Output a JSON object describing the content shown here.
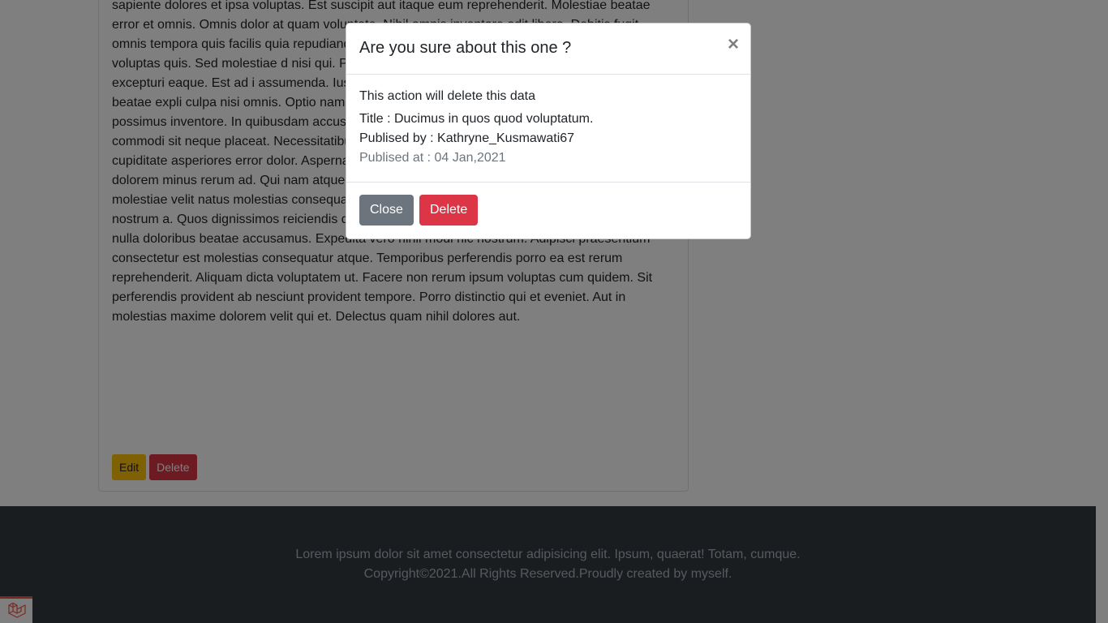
{
  "post": {
    "body": "sapiente dolores et ipsa voluptas. Est suscipit aut itaque eum reprehenderit. Molestiae beatae error et omnis. Omnis dolor at quam voluptate. Nihil omnis inventore odit libero. Debitis fugit omnis tempora quis facilis quia repudiandae. Voluptas earum ea quasi id soluta sit. Aut quae sunt voluptas quis. Sed molestiae d nisi qui. Porro dolor pariatur aut. Et sit co reiciendis culpa excepturi eaque. Est ad i assumenda. Iusto ratione sed quo enim v incidunt natus voluptas. Sed beatae expli culpa nisi omnis. Optio nam omnis quia d voluptatem commodi. Suscipit sit officia s possimus inventore. In quibusdam accus porro qui debitis nihil non. Praesentium neque non commodi sit neque placeat. Necessitatibus ipsa quia deserunt qui facere sint. Vero in dolorum cupiditate asperiores error dolor. Aspernatur impedit rerum cumque. Culpa blanditiis consequatur dolorem minus rerum ad. Qui nam atque iste sunt qui similique ipsam. Sequi sed repellat maiores molestiae velit natus molestias consequatur. Ab qui a magnam consequatur. Sint qui quod nostrum a. Quos dignissimos reiciendis deleniti in voluptatem illum. Alias provident quis magni nulla doloribus beatae accusamus. Expedita vero nihil modi hic nostrum. Adipisci praesentium consectetur est molestias consequatur atque. Temporibus perferendis porro ea est rerum reprehenderit. Aliquam dicta voluptatem ut. Facere non rerum ipsum voluptas cum quidem. Sit perferendis provident ab nesciunt provident tempore. Porro distinctio qui et eveniet. Aut in molestias maxime dolorem velit qui et. Delectus quam nihil dolores aut.",
    "edit_label": "Edit",
    "delete_label": "Delete"
  },
  "footer": {
    "line1": "Lorem ipsum dolor sit amet consectetur adipisicing elit. Ipsum, quaerat! Totam, cumque.",
    "line2": "Copyright©2021.All Rights Reserved.Proudly created by myself."
  },
  "modal": {
    "title": "Are you sure about this one ?",
    "close_symbol": "×",
    "message": "This action will delete this data",
    "title_line": "Title : Ducimus in quos quod voluptatum.",
    "published_by": "Publised by : Kathryne_Kusmawati67",
    "published_at": "Publised at : 04 Jan,2021",
    "close_label": "Close",
    "delete_label": "Delete"
  },
  "icons": {
    "debug": "laravel-logo-icon"
  },
  "colors": {
    "danger": "#dc3545",
    "secondary": "#6c757d",
    "warning": "#ffc107",
    "footer": "#343a40"
  }
}
